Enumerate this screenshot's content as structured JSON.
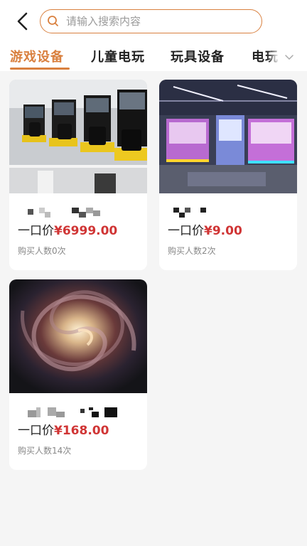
{
  "header": {
    "back_icon": "chevron-left-icon",
    "search": {
      "placeholder": "请输入搜索内容",
      "value": ""
    }
  },
  "tabs": [
    {
      "label": "游戏设备",
      "active": true
    },
    {
      "label": "儿童电玩",
      "active": false
    },
    {
      "label": "玩具设备",
      "active": false
    },
    {
      "label": "电玩",
      "active": false
    }
  ],
  "colors": {
    "accent": "#d9803f",
    "price": "#d03535"
  },
  "products": [
    {
      "price_label": "一口价",
      "price": "¥6999.00",
      "sales": "购买人数0次"
    },
    {
      "price_label": "一口价",
      "price": "¥9.00",
      "sales": "购买人数2次"
    },
    {
      "price_label": "一口价",
      "price": "¥168.00",
      "sales": "购买人数14次"
    }
  ]
}
